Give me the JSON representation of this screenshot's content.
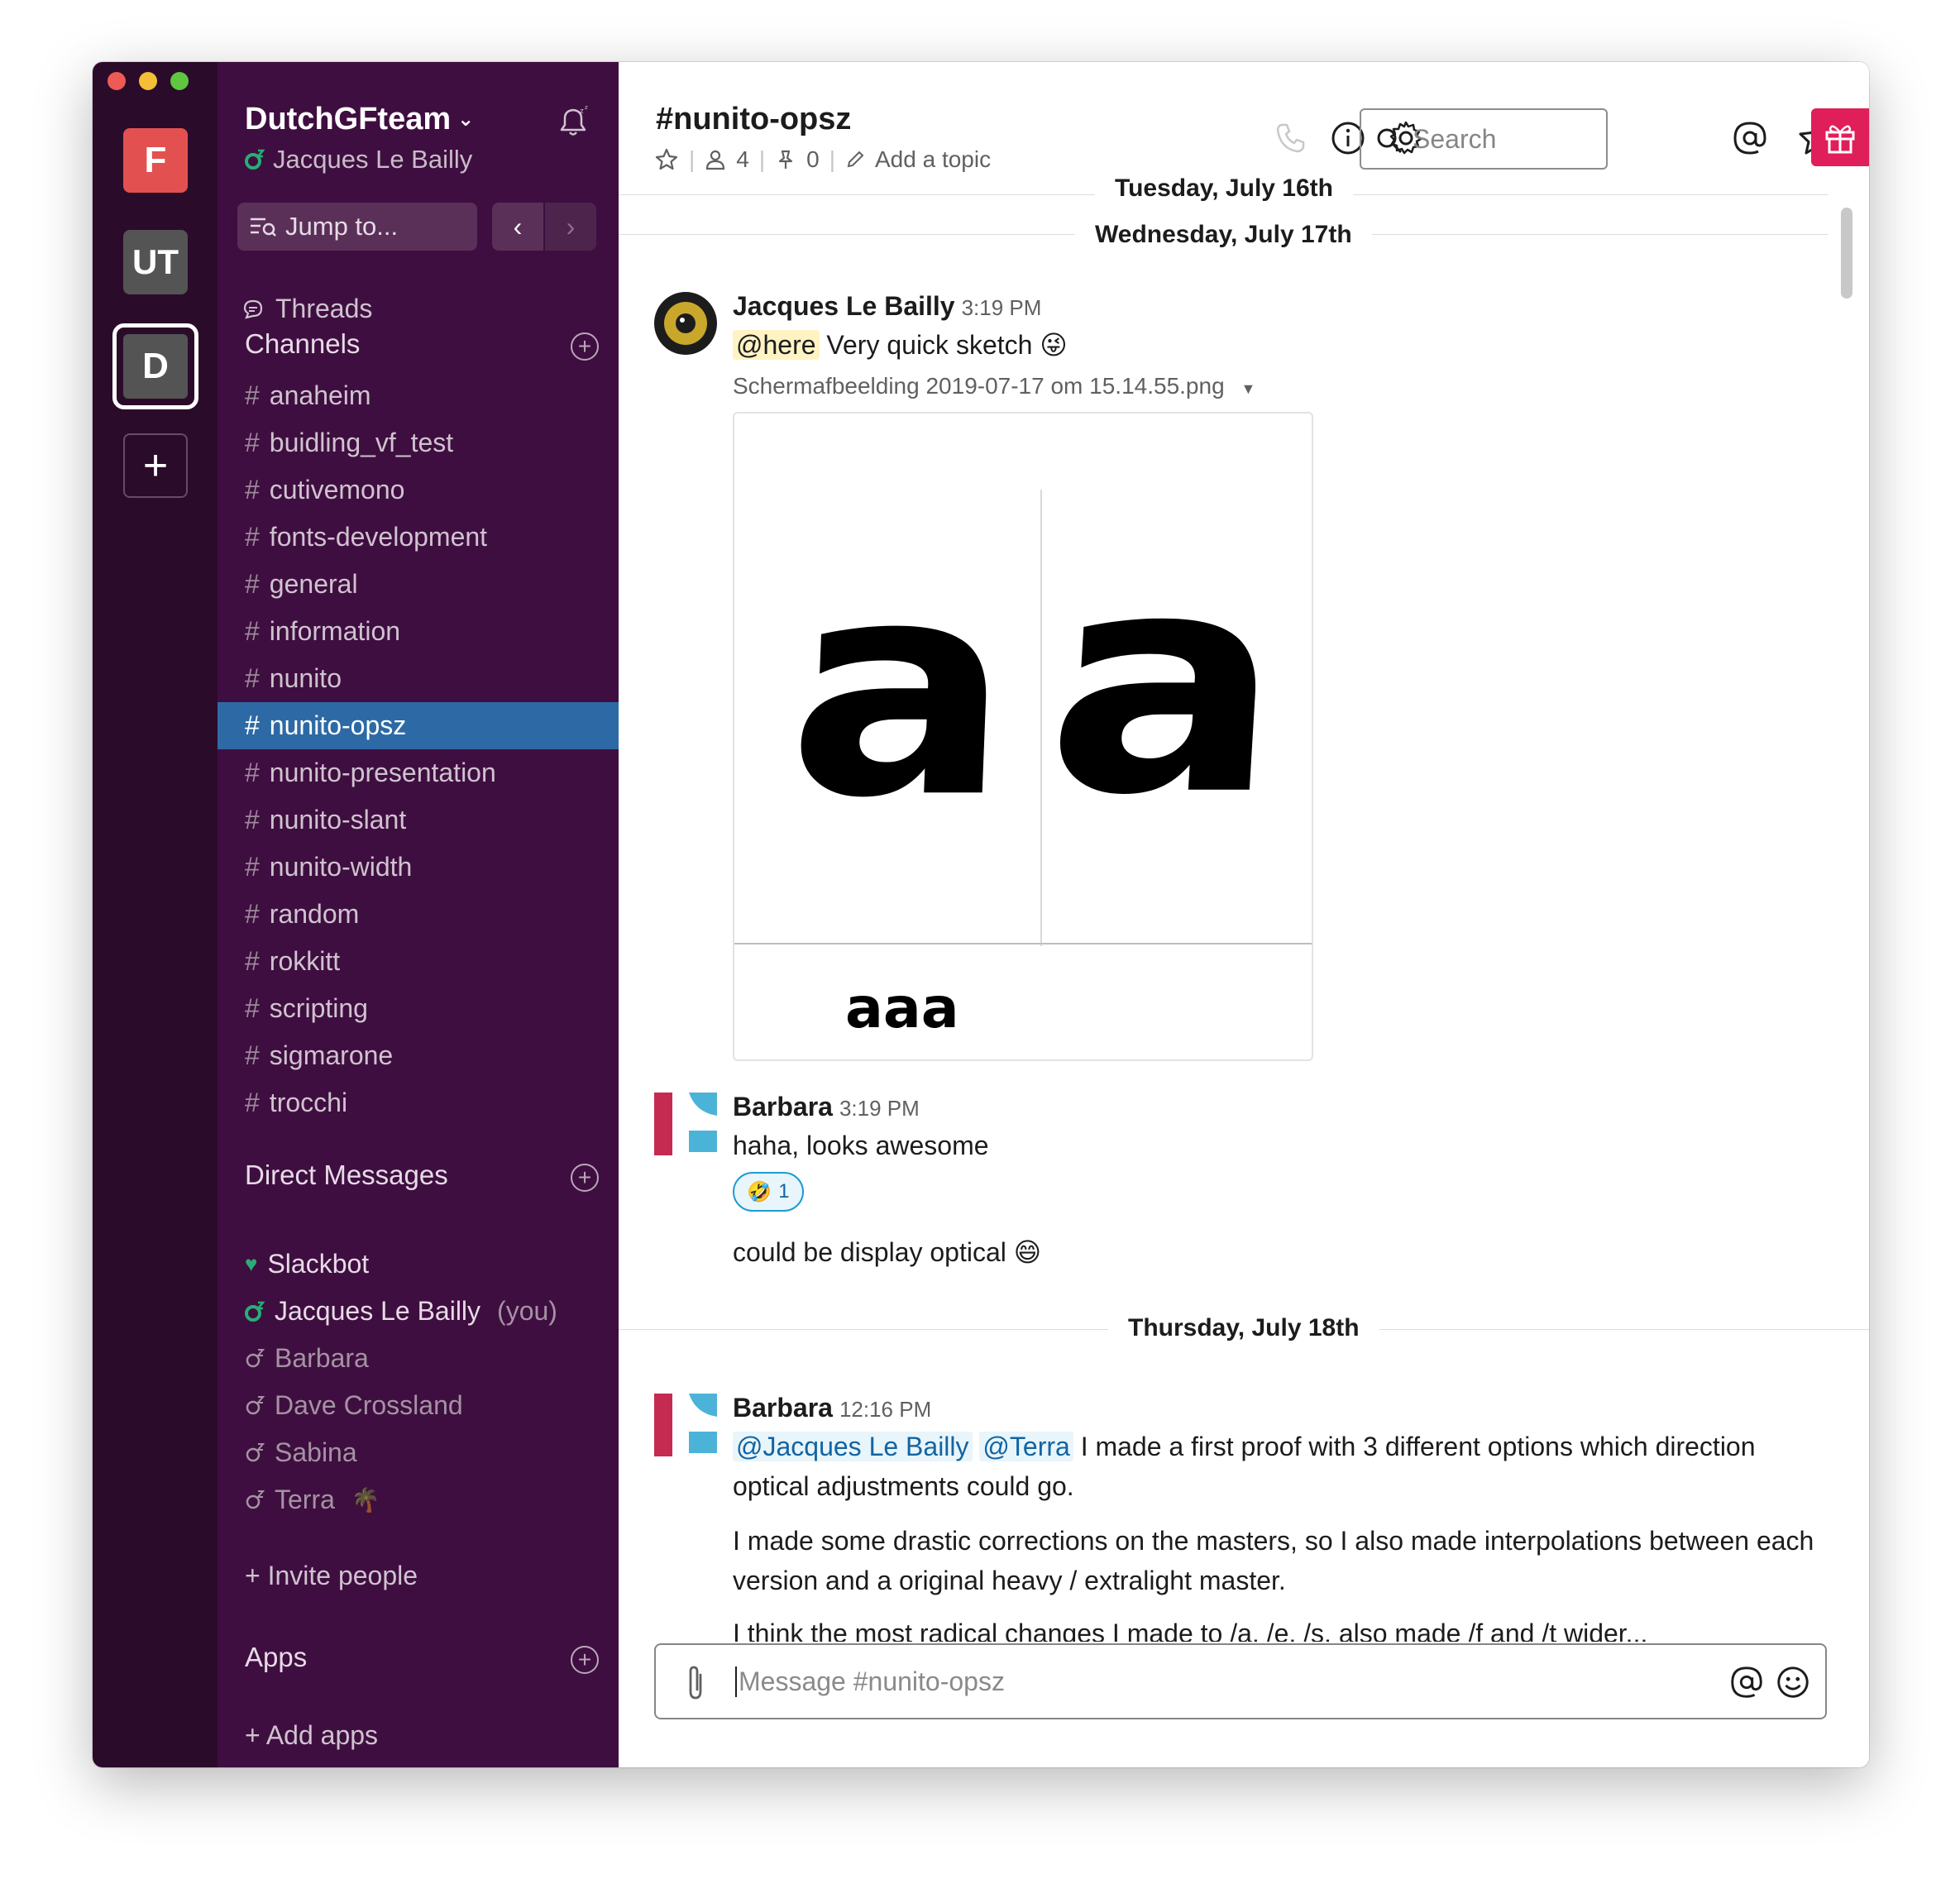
{
  "workspaces": [
    {
      "label": "F",
      "color": "#e2514f"
    },
    {
      "label": "UT",
      "color": "#545454"
    },
    {
      "label": "D",
      "color": "#545454"
    },
    {
      "label": "+"
    }
  ],
  "sidebar": {
    "team_name": "DutchGFteam",
    "current_user": "Jacques Le Bailly",
    "jump_to": "Jump to...",
    "threads": "Threads",
    "channels_title": "Channels",
    "channels": [
      "anaheim",
      "buidling_vf_test",
      "cutivemono",
      "fonts-development",
      "general",
      "information",
      "nunito",
      "nunito-opsz",
      "nunito-presentation",
      "nunito-slant",
      "nunito-width",
      "random",
      "rokkitt",
      "scripting",
      "sigmarone",
      "trocchi"
    ],
    "active_channel": "nunito-opsz",
    "dm_title": "Direct Messages",
    "dms": [
      {
        "name": "Slackbot",
        "status": "online"
      },
      {
        "name": "Jacques Le Bailly",
        "suffix": "(you)",
        "status": "online"
      },
      {
        "name": "Barbara",
        "status": "offline"
      },
      {
        "name": "Dave Crossland",
        "status": "offline"
      },
      {
        "name": "Sabina",
        "status": "offline"
      },
      {
        "name": "Terra",
        "status": "offline",
        "emoji": "🌴"
      }
    ],
    "invite": "Invite people",
    "apps_title": "Apps",
    "add_apps": "Add apps",
    "hash": "#",
    "plus": "+"
  },
  "header": {
    "channel_title": "#nunito-opsz",
    "members": "4",
    "pins": "0",
    "add_topic": "Add a topic",
    "search_placeholder": "Search"
  },
  "dates": {
    "d1": "Tuesday, July 16th",
    "d2": "Wednesday, July 17th",
    "d3": "Thursday, July 18th"
  },
  "messages": {
    "m1": {
      "author": "Jacques Le Bailly",
      "time": "3:19 PM",
      "mention": "@here",
      "text": "Very quick sketch",
      "emoji": "😜",
      "file_name": "Schermafbeelding 2019-07-17 om 15.14.55.png",
      "image_glyph_large": "a",
      "image_glyph_small": "aaa"
    },
    "m2": {
      "author": "Barbara",
      "time": "3:19 PM",
      "text": "haha, looks awesome",
      "reaction_emoji": "🤣",
      "reaction_count": "1",
      "text2": "could be display optical",
      "emoji2": "😄"
    },
    "m3": {
      "author": "Barbara",
      "time": "12:16 PM",
      "mention1": "@Jacques Le Bailly",
      "mention2": "@Terra",
      "text1": "I made a first proof with 3 different options which direction optical adjustments could go.",
      "text2": "I made some drastic corrections on the masters, so I also made interpolations between each version and a original heavy / extralight master.",
      "text3": "I think the most radical changes I made to /a, /e, /s, also made /f and /t wider..."
    }
  },
  "composer": {
    "placeholder": "Message #nunito-opsz"
  },
  "colors": {
    "sidebar_bg": "#3f0e40",
    "rail_bg": "#2b0b2a",
    "active_channel": "#2d6aa5",
    "gift": "#e01e5a",
    "online": "#2bac76"
  }
}
